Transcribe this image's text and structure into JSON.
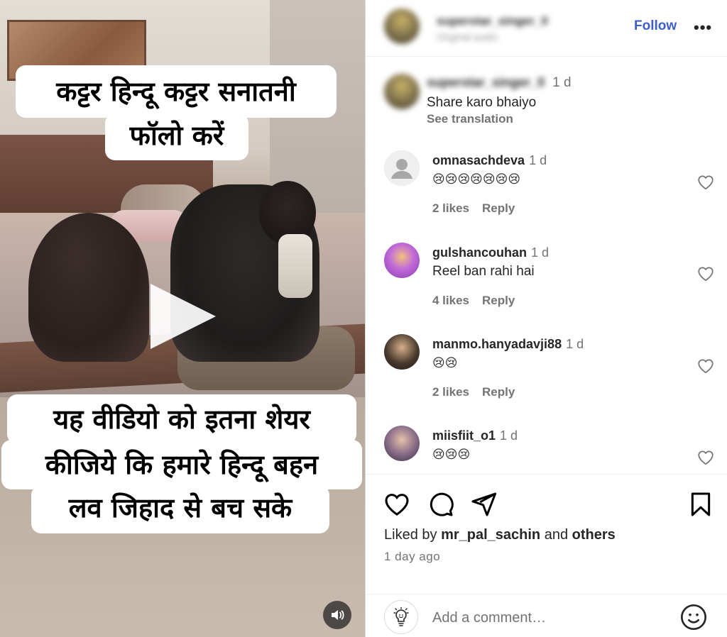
{
  "video": {
    "caption_top_lines": [
      "कट्टर हिन्दू कट्टर सनातनी",
      "फॉलो करें"
    ],
    "caption_bottom_lines": [
      "यह वीडियो को इतना शेयर",
      "कीजिये कि हमारे हिन्दू बहन",
      "लव जिहाद से बच सके"
    ],
    "play_icon": "play-icon",
    "sound_icon": "speaker-icon"
  },
  "header": {
    "username": "superstar_singer_0",
    "subtitle": "Original audio",
    "follow_label": "Follow",
    "more_label": "•••"
  },
  "caption_comment": {
    "username": "superstar_singer_0",
    "time": "1 d",
    "text": "Share karo bhaiyo",
    "see_translation": "See translation"
  },
  "comments": [
    {
      "username": "omnasachdeva",
      "time": "1 d",
      "text": "😢😢😢😢😢😢😢",
      "likes": "2 likes",
      "reply": "Reply"
    },
    {
      "username": "gulshancouhan",
      "time": "1 d",
      "text": "Reel ban rahi hai",
      "likes": "4 likes",
      "reply": "Reply"
    },
    {
      "username": "manmo.hanyadavji88",
      "time": "1 d",
      "text": "😢😢",
      "likes": "2 likes",
      "reply": "Reply"
    },
    {
      "username": "miisfiit_o1",
      "time": "1 d",
      "text": "😢😢😢"
    }
  ],
  "actions": {
    "liked_prefix": "Liked by",
    "liked_user": "mr_pal_sachin",
    "liked_and": "and",
    "liked_others": "others",
    "time_ago": "1 day ago"
  },
  "add_comment": {
    "placeholder": "Add a comment…"
  },
  "colors": {
    "follow_blue": "#3e5ec9",
    "muted_text": "#737373",
    "primary_text": "#262626"
  }
}
